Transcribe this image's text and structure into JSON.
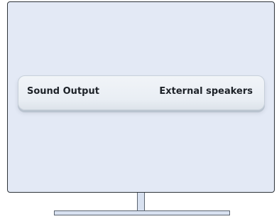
{
  "setting": {
    "label": "Sound Output",
    "value": "External speakers"
  }
}
